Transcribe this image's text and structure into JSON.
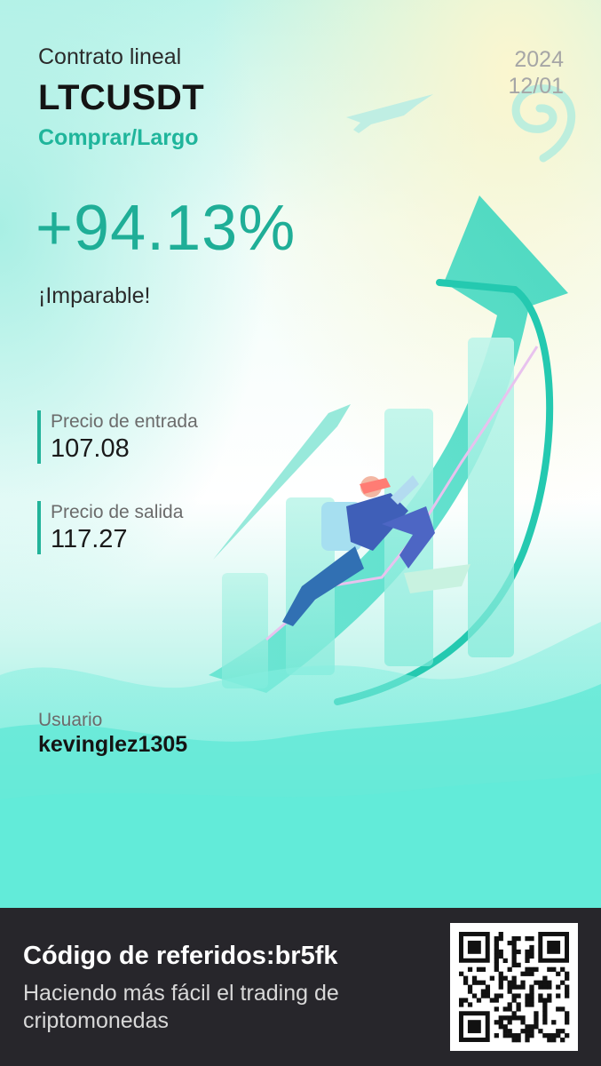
{
  "header": {
    "contract_type": "Contrato lineal",
    "symbol": "LTCUSDT",
    "side": "Comprar/Largo",
    "date_year": "2024",
    "date_month_day": "12/01"
  },
  "result": {
    "pnl_percent": "+94.13%",
    "slogan": "¡Imparable!"
  },
  "prices": {
    "entry_label": "Precio de entrada",
    "entry_value": "107.08",
    "exit_label": "Precio de salida",
    "exit_value": "117.27"
  },
  "user": {
    "label": "Usuario",
    "name": "kevinglez1305"
  },
  "footer": {
    "referral": "Código de referidos:br5fk",
    "tagline": "Haciendo más fácil el trading de criptomonedas",
    "qr_icon": "qr-code-icon"
  },
  "colors": {
    "accent": "#1fae97",
    "footer_bg": "#27262b",
    "teal_bg": "#5ee8d6"
  }
}
